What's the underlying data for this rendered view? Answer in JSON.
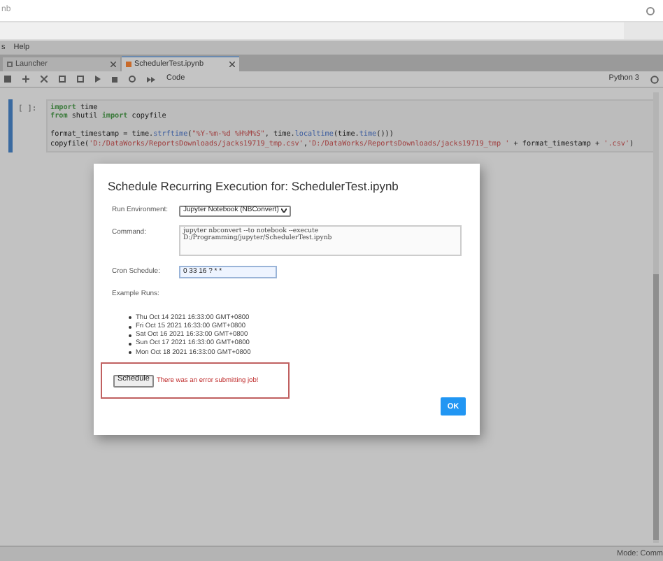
{
  "browser": {
    "title_fragment": "nb"
  },
  "menu": [
    {
      "label": "s"
    },
    {
      "label": "Help"
    }
  ],
  "tabs": [
    {
      "label": "Launcher",
      "selected": false
    },
    {
      "label": "SchedulerTest.ipynb",
      "selected": true
    }
  ],
  "toolbar": {
    "cell_type": "Code",
    "kernel": "Python 3"
  },
  "cell": {
    "prompt": "[ ]:",
    "lines": [
      {
        "gap_before": false,
        "tokens": [
          {
            "kind": "keyword",
            "text": "import"
          },
          {
            "kind": "plain",
            "text": " time"
          }
        ]
      },
      {
        "gap_before": false,
        "tokens": [
          {
            "kind": "keyword",
            "text": "from"
          },
          {
            "kind": "plain",
            "text": " shutil "
          },
          {
            "kind": "keyword",
            "text": "import"
          },
          {
            "kind": "plain",
            "text": " copyfile"
          }
        ]
      },
      {
        "gap_before": true,
        "tokens": [
          {
            "kind": "plain",
            "text": "format_timestamp = time."
          },
          {
            "kind": "func",
            "text": "strftime"
          },
          {
            "kind": "plain",
            "text": "("
          },
          {
            "kind": "string",
            "text": "\"%Y-%m-%d %H%M%S\""
          },
          {
            "kind": "plain",
            "text": ", time."
          },
          {
            "kind": "func",
            "text": "localtime"
          },
          {
            "kind": "plain",
            "text": "(time."
          },
          {
            "kind": "func",
            "text": "time"
          },
          {
            "kind": "plain",
            "text": "()))"
          }
        ]
      },
      {
        "gap_before": false,
        "tokens": [
          {
            "kind": "plain",
            "text": "copyfile("
          },
          {
            "kind": "string",
            "text": "'D:/DataWorks/ReportsDownloads/jacks19719_tmp.csv'"
          },
          {
            "kind": "plain",
            "text": ","
          },
          {
            "kind": "string",
            "text": "'D:/DataWorks/ReportsDownloads/jacks19719_tmp '"
          },
          {
            "kind": "plain",
            "text": " + format_timestamp + "
          },
          {
            "kind": "string",
            "text": "'.csv'"
          },
          {
            "kind": "plain",
            "text": ")"
          }
        ]
      }
    ]
  },
  "dialog": {
    "title": "Schedule Recurring Execution for: SchedulerTest.ipynb",
    "run_environment": {
      "label": "Run Environment:",
      "value": "Jupyter Notebook (NBConvert)"
    },
    "command": {
      "label": "Command:",
      "value": "jupyter nbconvert --to notebook --execute\nD:/Programming/jupyter/SchedulerTest.ipynb"
    },
    "cron": {
      "label": "Cron Schedule:",
      "value": "0 33 16 ? * *"
    },
    "example_runs": {
      "label": "Example Runs:",
      "items": [
        "Thu Oct 14 2021 16:33:00 GMT+0800",
        "Fri Oct 15 2021 16:33:00 GMT+0800",
        "Sat Oct 16 2021 16:33:00 GMT+0800",
        "Sun Oct 17 2021 16:33:00 GMT+0800",
        "Mon Oct 18 2021 16:33:00 GMT+0800"
      ]
    },
    "schedule_button": "Schedule",
    "error": "There was an error submitting job!",
    "ok_button": "OK"
  },
  "status_bar": {
    "mode": "Mode: Comm"
  }
}
